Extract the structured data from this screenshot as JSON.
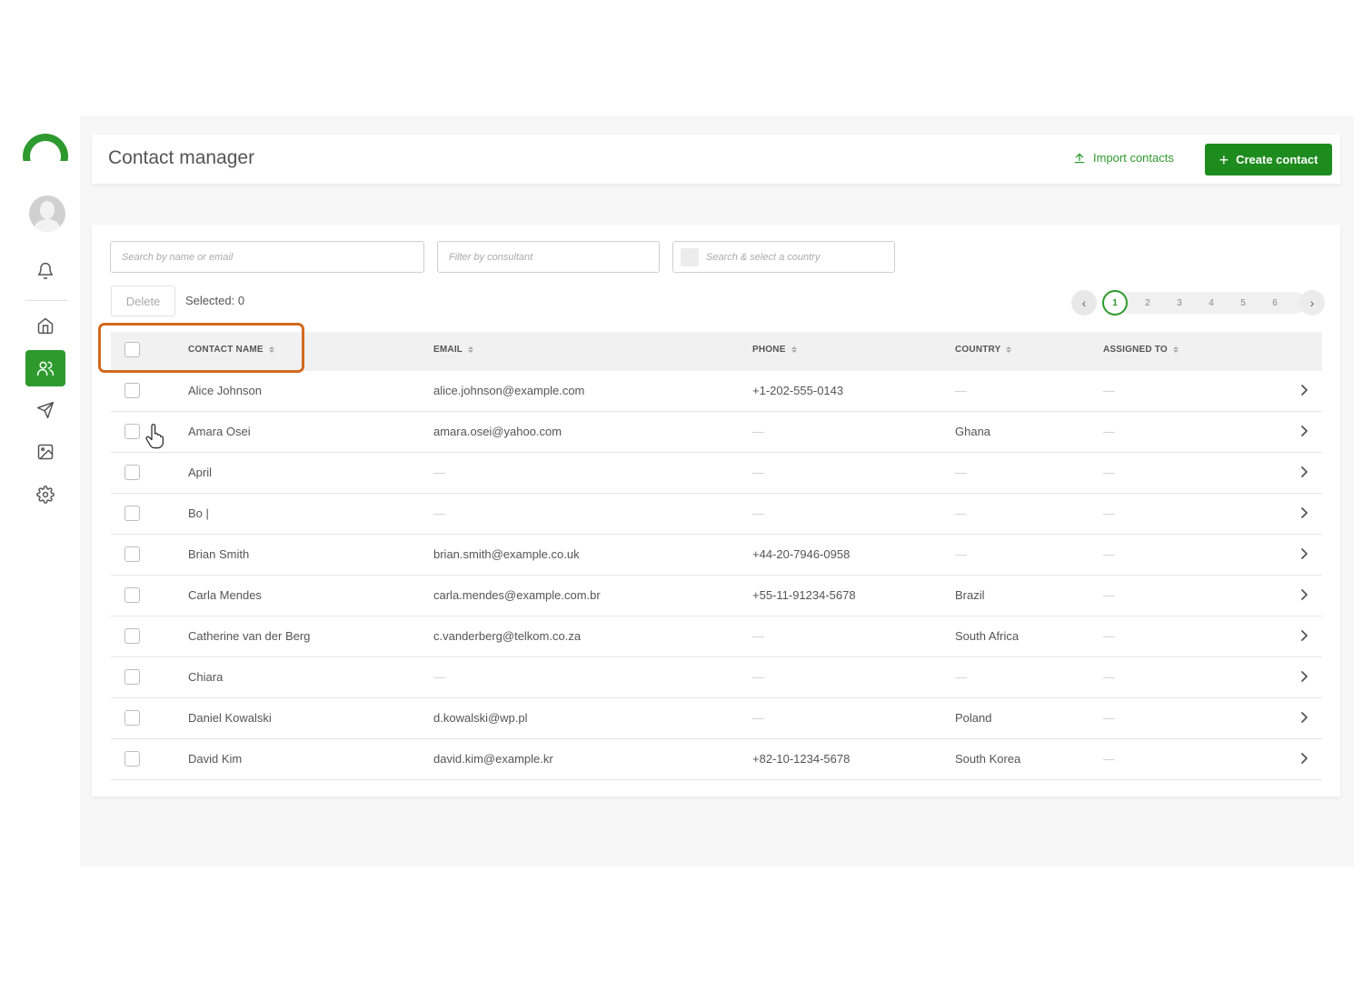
{
  "header": {
    "title": "Contact manager",
    "import_label": "Import contacts",
    "create_label": "Create contact"
  },
  "filters": {
    "search_placeholder": "Search by name or email",
    "consultant_placeholder": "Filter by consultant",
    "country_placeholder": "Search & select a country"
  },
  "toolbar": {
    "delete_label": "Delete",
    "selected_label": "Selected: 0"
  },
  "pagination": {
    "current": "1",
    "pages": [
      "1",
      "2",
      "3",
      "4",
      "5",
      "6"
    ]
  },
  "table": {
    "columns": [
      "CONTACT NAME",
      "EMAIL",
      "PHONE",
      "COUNTRY",
      "ASSIGNED TO"
    ],
    "empty_symbol": "—",
    "rows": [
      {
        "name": "Alice Johnson",
        "email": "alice.johnson@example.com",
        "phone": "+1-202-555-0143",
        "country": "—",
        "assigned": "—"
      },
      {
        "name": "Amara Osei",
        "email": "amara.osei@yahoo.com",
        "phone": "—",
        "country": "Ghana",
        "assigned": "—"
      },
      {
        "name": "April",
        "email": "—",
        "phone": "—",
        "country": "—",
        "assigned": "—"
      },
      {
        "name": "Bo |",
        "email": "—",
        "phone": "—",
        "country": "—",
        "assigned": "—"
      },
      {
        "name": "Brian Smith",
        "email": "brian.smith@example.co.uk",
        "phone": "+44-20-7946-0958",
        "country": "—",
        "assigned": "—"
      },
      {
        "name": "Carla Mendes",
        "email": "carla.mendes@example.com.br",
        "phone": "+55-11-91234-5678",
        "country": "Brazil",
        "assigned": "—"
      },
      {
        "name": "Catherine van der Berg",
        "email": "c.vanderberg@telkom.co.za",
        "phone": "—",
        "country": "South Africa",
        "assigned": "—"
      },
      {
        "name": "Chiara",
        "email": "—",
        "phone": "—",
        "country": "—",
        "assigned": "—"
      },
      {
        "name": "Daniel Kowalski",
        "email": "d.kowalski@wp.pl",
        "phone": "—",
        "country": "Poland",
        "assigned": "—"
      },
      {
        "name": "David Kim",
        "email": "david.kim@example.kr",
        "phone": "+82-10-1234-5678",
        "country": "South Korea",
        "assigned": "—"
      }
    ]
  },
  "colors": {
    "brand_green": "#1d8b1d",
    "highlight": "#d2691e"
  },
  "sidebar": {
    "icons": [
      "bell-icon",
      "home-icon",
      "contacts-icon",
      "send-icon",
      "image-icon",
      "settings-icon"
    ]
  }
}
